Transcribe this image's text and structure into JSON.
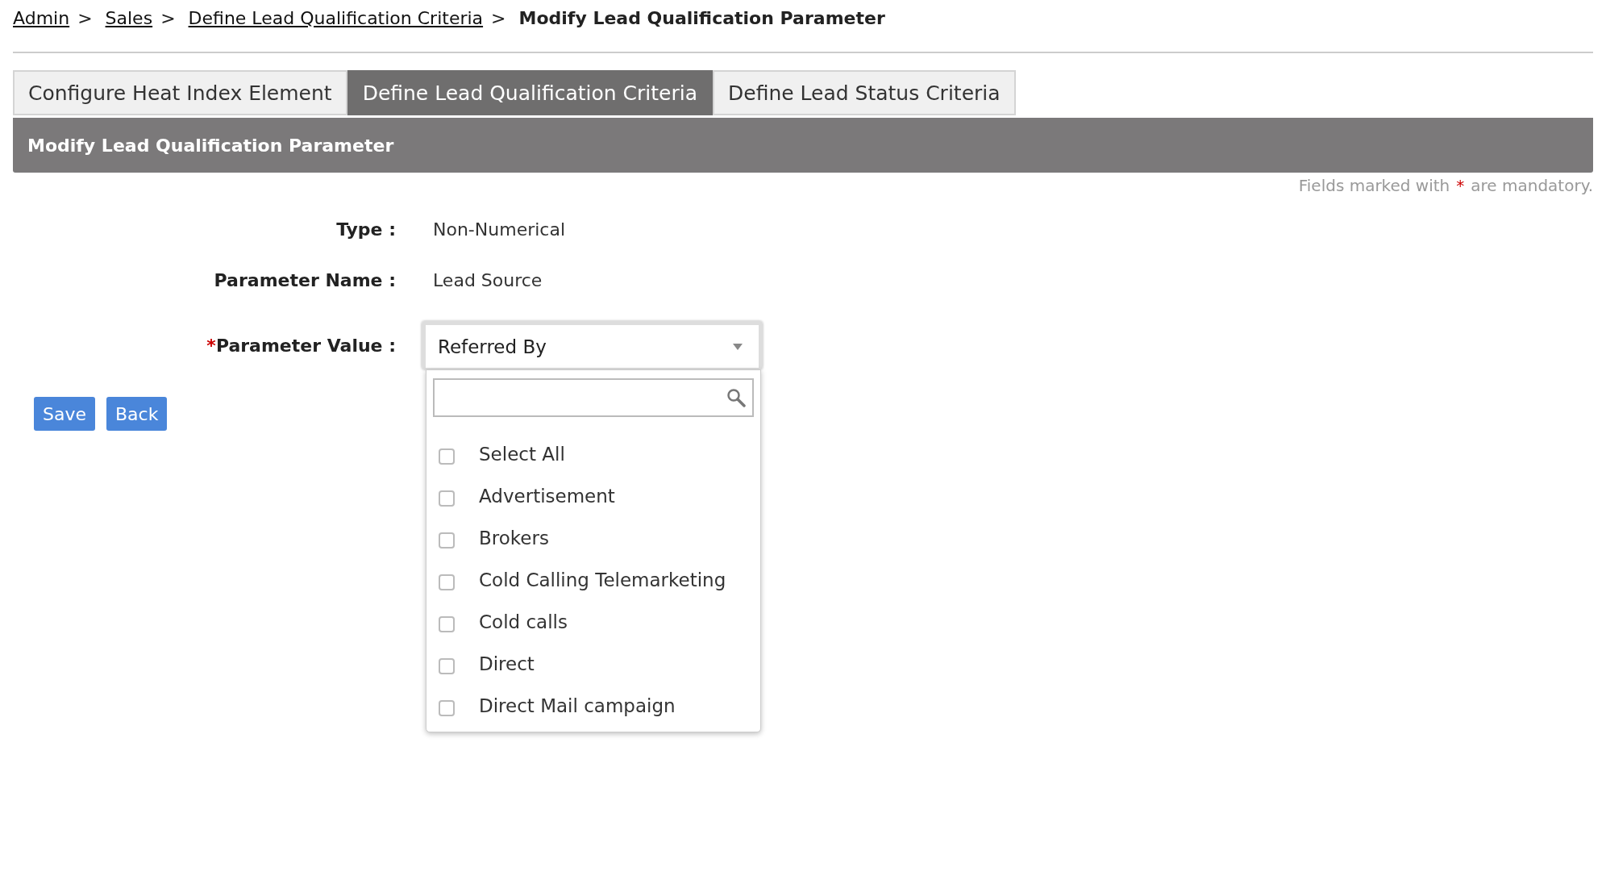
{
  "breadcrumb": {
    "links": [
      "Admin",
      "Sales",
      "Define Lead Qualification Criteria"
    ],
    "separator": ">",
    "current": "Modify Lead Qualification Parameter"
  },
  "tabs": [
    {
      "label": "Configure Heat Index Element",
      "selected": false
    },
    {
      "label": "Define Lead Qualification Criteria",
      "selected": true
    },
    {
      "label": "Define Lead Status Criteria",
      "selected": false
    }
  ],
  "section_title": "Modify Lead Qualification Parameter",
  "mandatory_note": {
    "before": "Fields marked with",
    "mark": "*",
    "after": "are mandatory."
  },
  "fields": [
    {
      "label": "Type :",
      "kind": "text",
      "value": "Non-Numerical"
    },
    {
      "label": "Parameter Name :",
      "kind": "text",
      "value": "Lead Source"
    },
    {
      "label": "Parameter Value :",
      "required_mark": "*",
      "kind": "dropdown",
      "value": "Referred By",
      "expanded": true,
      "options": [
        {
          "label": "Select All",
          "checked": false
        },
        {
          "label": "Advertisement",
          "checked": false
        },
        {
          "label": "Brokers",
          "checked": false
        },
        {
          "label": "Cold Calling Telemarketing",
          "checked": false
        },
        {
          "label": "Cold calls",
          "checked": false
        },
        {
          "label": "Direct",
          "checked": false
        },
        {
          "label": "Direct Mail campaign",
          "checked": false
        }
      ]
    }
  ],
  "buttons": [
    "Save",
    "Back"
  ]
}
